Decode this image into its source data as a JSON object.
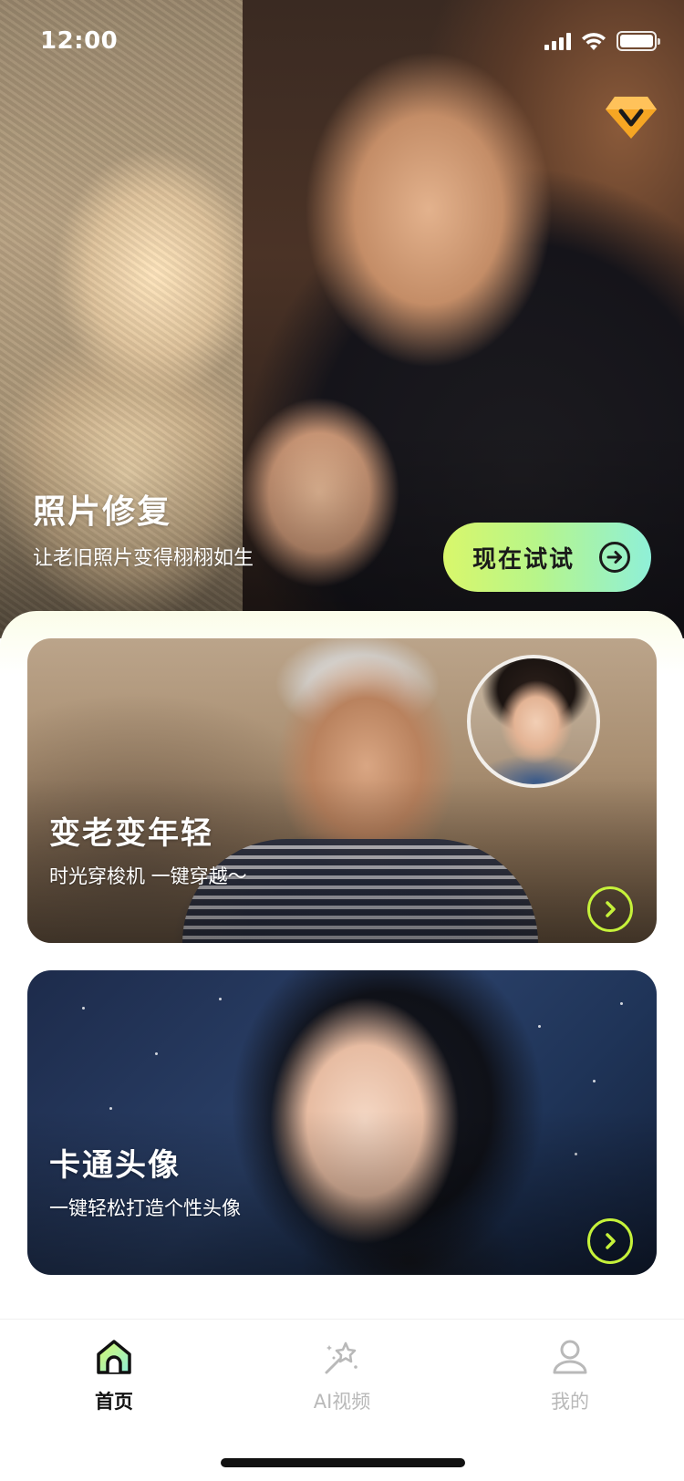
{
  "status_bar": {
    "time": "12:00"
  },
  "hero": {
    "title": "照片修复",
    "subtitle": "让老旧照片变得栩栩如生",
    "cta_label": "现在试试"
  },
  "cards": [
    {
      "title": "变老变年轻",
      "subtitle": "时光穿梭机 一键穿越～"
    },
    {
      "title": "卡通头像",
      "subtitle": "一键轻松打造个性头像"
    }
  ],
  "tabs": [
    {
      "label": "首页",
      "icon": "home-icon",
      "active": true
    },
    {
      "label": "AI视频",
      "icon": "magic-wand-icon",
      "active": false
    },
    {
      "label": "我的",
      "icon": "user-icon",
      "active": false
    }
  ],
  "colors": {
    "accent": "#c6f23a",
    "cta_gradient_start": "#d9f76b",
    "cta_gradient_end": "#8ff0d8",
    "vip": "#f6a623"
  }
}
